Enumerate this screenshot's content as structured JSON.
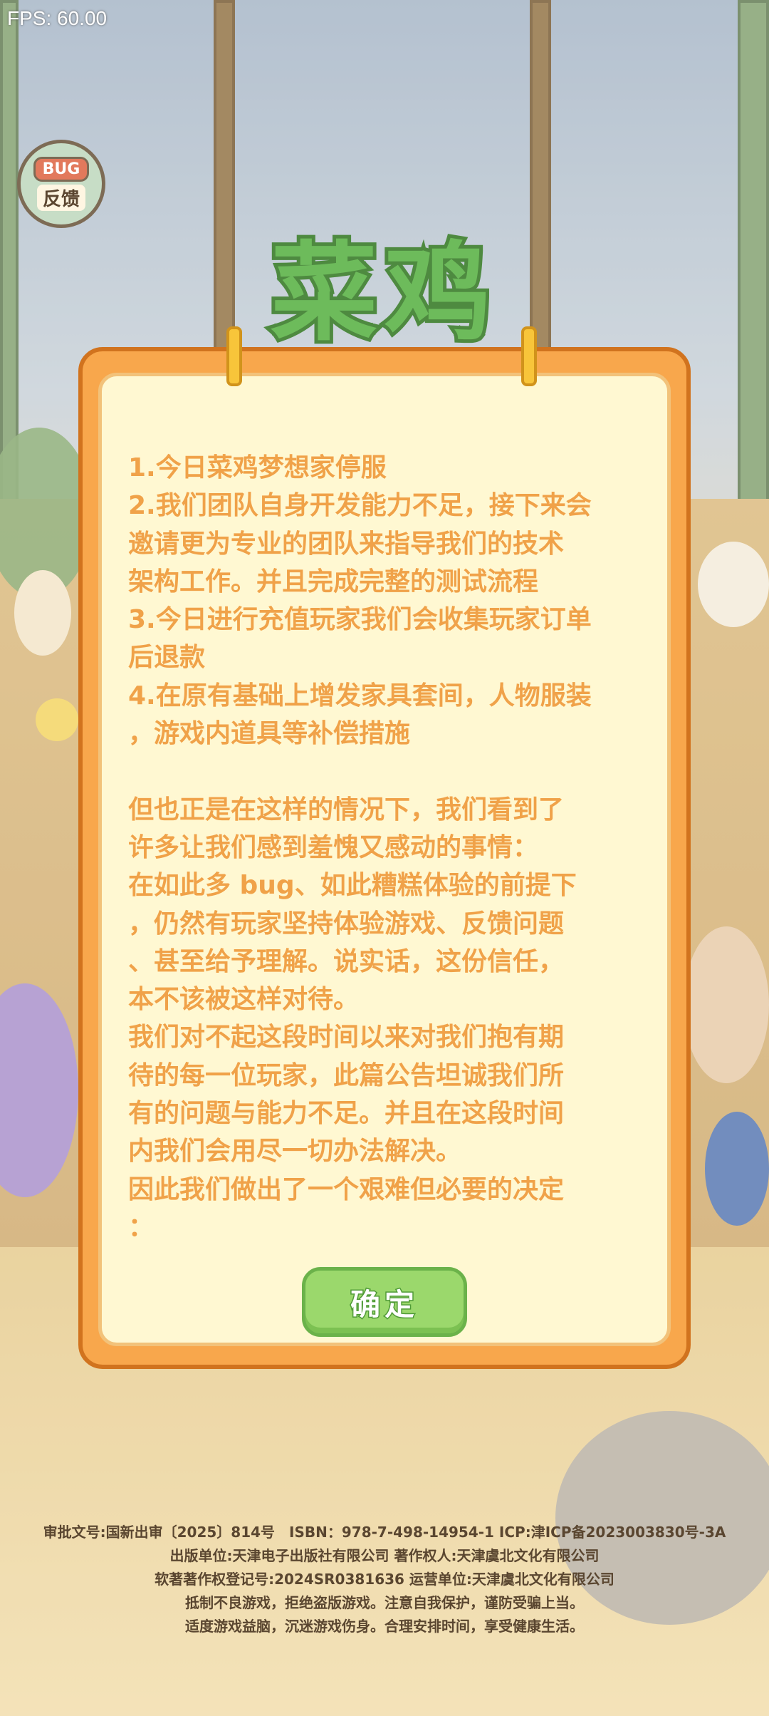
{
  "fps": "FPS: 60.00",
  "bug_button": {
    "tag": "BUG",
    "label": "反馈"
  },
  "logo_text": "菜鸡",
  "notice_lines": [
    "1.今日菜鸡梦想家停服",
    "2.我们团队自身开发能力不足，接下来会",
    "邀请更为专业的团队来指导我们的技术",
    "架构工作。并且完成完整的测试流程",
    "3.今日进行充值玩家我们会收集玩家订单",
    "后退款",
    "4.在原有基础上增发家具套间，人物服装",
    "，游戏内道具等补偿措施",
    "",
    "但也正是在这样的情况下，我们看到了",
    "许多让我们感到羞愧又感动的事情：",
    "在如此多 bug、如此糟糕体验的前提下",
    "，仍然有玩家坚持体验游戏、反馈问题",
    "、甚至给予理解。说实话，这份信任，",
    "本不该被这样对待。",
    "我们对不起这段时间以来对我们抱有期",
    "待的每一位玩家，此篇公告坦诚我们所",
    "有的问题与能力不足。并且在这段时间",
    "内我们会用尽一切办法解决。",
    "因此我们做出了一个艰难但必要的决定",
    "："
  ],
  "confirm_label": "确定",
  "footer_lines": [
    "审批文号:国新出审〔2025〕814号　ISBN：978-7-498-14954-1  ICP:津ICP备2023003830号-3A",
    "出版单位:天津电子出版社有限公司  著作权人:天津虞北文化有限公司",
    "软著著作权登记号:2024SR0381636  运营单位:天津虞北文化有限公司",
    "抵制不良游戏，拒绝盗版游戏。注意自我保护，谨防受骗上当。",
    "适度游戏益脑，沉迷游戏伤身。合理安排时间，享受健康生活。"
  ],
  "colors": {
    "panel": "#f8a74c",
    "panel_inner": "#fff8d2",
    "notice_text": "#f0a249",
    "confirm": "#9bd86c"
  }
}
